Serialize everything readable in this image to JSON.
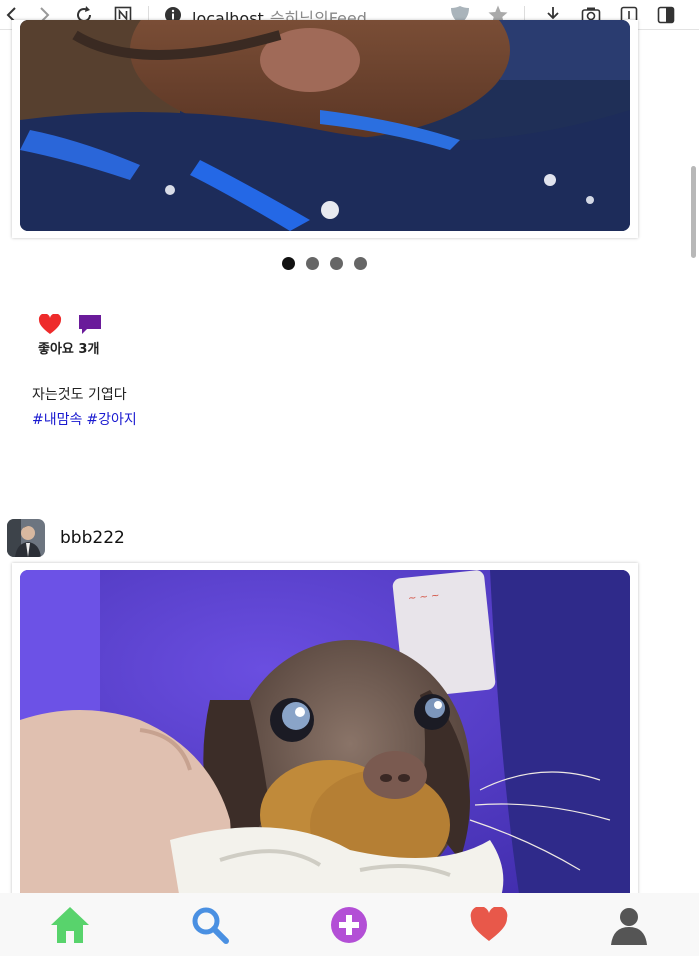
{
  "browser": {
    "url_host": "localhost",
    "page_title": "승히님의Feed"
  },
  "post1": {
    "carousel": {
      "count": 4,
      "active_index": 0
    },
    "likes_text": "좋아요 3개",
    "caption": "자는것도 기엽다",
    "hashtags": [
      "#내맘속",
      "#강아지"
    ]
  },
  "post2": {
    "username": "bbb222"
  },
  "nav": {
    "items": [
      "home-icon",
      "search-icon",
      "add-post-icon",
      "likes-heart-icon",
      "profile-icon"
    ],
    "colors": {
      "home": "#58d36c",
      "search": "#4a90e2",
      "add": "#b34fd6",
      "heart": "#e8584a",
      "profile": "#555555"
    }
  },
  "colors": {
    "like_heart": "#ee2b2b",
    "comment": "#6a1b9a",
    "hashtag": "#1a1ad0"
  }
}
